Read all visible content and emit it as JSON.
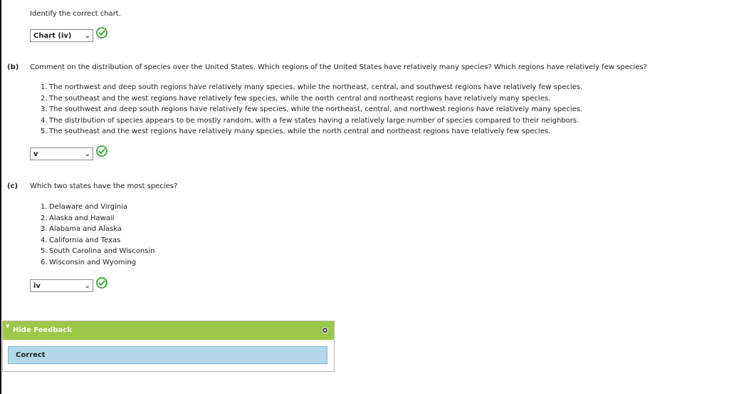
{
  "intro": {
    "text": "Identify the correct chart."
  },
  "select_a": {
    "value": "Chart (iv)"
  },
  "part_b": {
    "label": "(b)",
    "question": "Comment on the distribution of species over the United States. Which regions of the United States have relatively many species? Which regions have relatively few species?",
    "options": [
      {
        "num": "1.",
        "text": "The northwest and deep south regions have relatively many species, while the northeast, central, and southwest regions have relatively few species."
      },
      {
        "num": "2.",
        "text": "The southeast and the west regions have relatively few species, while the north central and northeast regions have relatively many species."
      },
      {
        "num": "3.",
        "text": "The southwest and deep south regions have relatively few species, while the northeast, central, and northwest regions have relatively many species."
      },
      {
        "num": "4.",
        "text": "The distribution of species appears to be mostly random, with a few states having a relatively large number of species compared to their neighbors."
      },
      {
        "num": "5.",
        "text": "The southeast and the west regions have relatively many species, while the north central and northeast regions have relatively few species."
      }
    ],
    "select_value": "v"
  },
  "part_c": {
    "label": "(c)",
    "question": "Which two states have the most species?",
    "options": [
      {
        "num": "1.",
        "text": "Delaware and Virginia"
      },
      {
        "num": "2.",
        "text": "Alaska and Hawaii"
      },
      {
        "num": "3.",
        "text": "Alabama and Alaska"
      },
      {
        "num": "4.",
        "text": "California and Texas"
      },
      {
        "num": "5.",
        "text": "South Carolina and Wisconsin"
      },
      {
        "num": "6.",
        "text": "Wisconsin and Wyoming"
      }
    ],
    "select_value": "iv"
  },
  "feedback": {
    "header": "Hide Feedback",
    "result": "Correct"
  },
  "colors": {
    "check_green": "#3aa635",
    "feedback_header": "#9cc847",
    "feedback_body": "#b3d8ea"
  },
  "icons": {
    "check": "check-circle-icon",
    "chevron": "chevron-down-icon",
    "toggle": "triangle-down-icon",
    "close": "circle-close-icon"
  }
}
